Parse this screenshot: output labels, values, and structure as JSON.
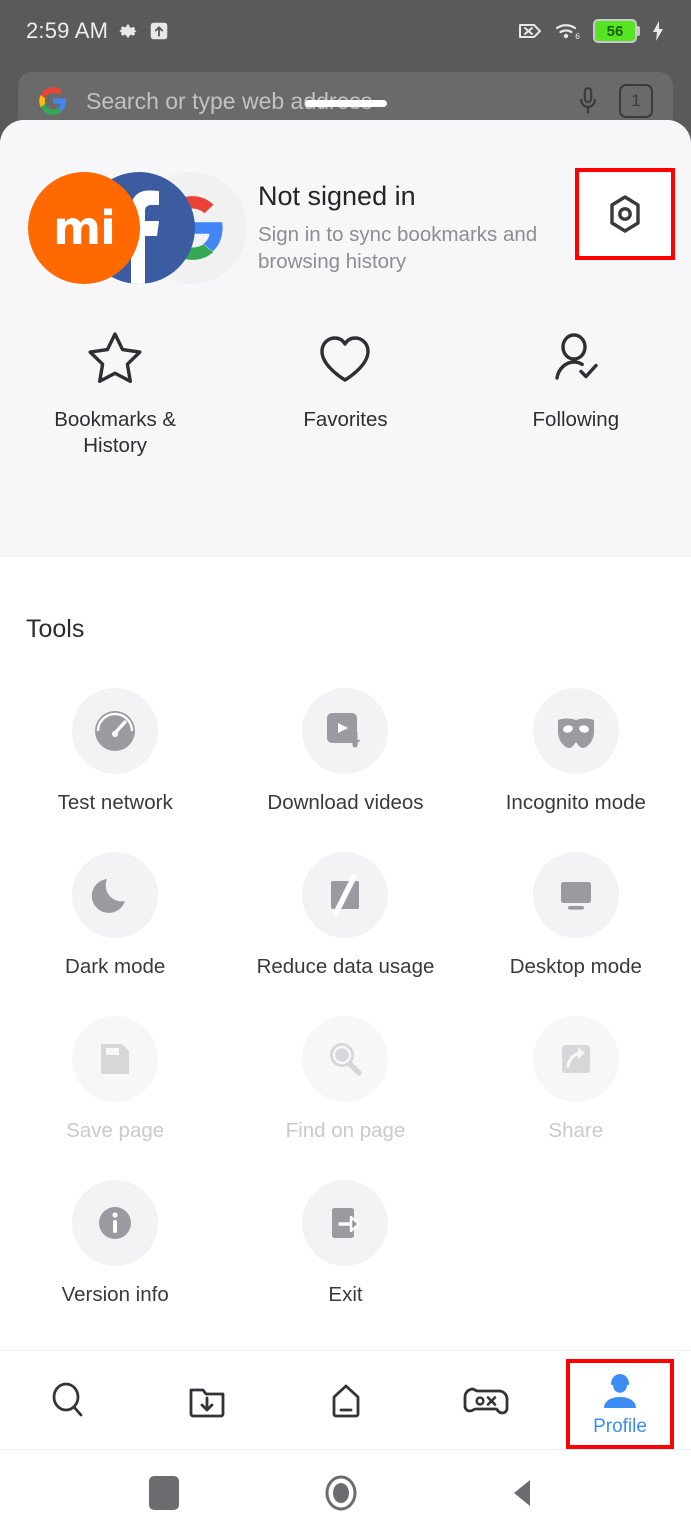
{
  "statusbar": {
    "time": "2:59 AM",
    "left_icons": [
      "gear-icon",
      "upload-box-icon"
    ],
    "right_icons": [
      "no-sim-icon",
      "wifi-6-icon",
      "battery-icon",
      "charging-bolt-icon"
    ],
    "battery_percent": "56",
    "battery_color": "#57e523"
  },
  "urlbar": {
    "placeholder": "Search or type web address",
    "leading_icon": "google-g-icon",
    "mic_icon": "microphone-icon",
    "tab_count": "1"
  },
  "account": {
    "title": "Not signed in",
    "subtitle": "Sign in to sync bookmarks and browsing history",
    "avatars": [
      {
        "name": "mi-avatar",
        "glyph": "mi",
        "color": "#ff6900"
      },
      {
        "name": "facebook-avatar",
        "glyph": "f",
        "color": "#3b5ca0"
      },
      {
        "name": "google-avatar",
        "glyph": "G",
        "color": "#f1f1f1"
      }
    ],
    "settings_icon": "settings-hex-icon",
    "settings_highlight_color": "#fe0000"
  },
  "shortcuts": [
    {
      "label": "Bookmarks & History",
      "icon": "star-icon"
    },
    {
      "label": "Favorites",
      "icon": "heart-icon"
    },
    {
      "label": "Following",
      "icon": "person-check-icon"
    }
  ],
  "tools": {
    "title": "Tools",
    "items": [
      {
        "label": "Test network",
        "icon": "speedometer-icon",
        "disabled": false
      },
      {
        "label": "Download videos",
        "icon": "video-download-icon",
        "disabled": false
      },
      {
        "label": "Incognito mode",
        "icon": "mask-icon",
        "disabled": false
      },
      {
        "label": "Dark mode",
        "icon": "moon-icon",
        "disabled": false
      },
      {
        "label": "Reduce data usage",
        "icon": "data-saver-icon",
        "disabled": false
      },
      {
        "label": "Desktop mode",
        "icon": "monitor-icon",
        "disabled": false
      },
      {
        "label": "Save page",
        "icon": "save-page-icon",
        "disabled": true
      },
      {
        "label": "Find on page",
        "icon": "magnifier-icon",
        "disabled": true
      },
      {
        "label": "Share",
        "icon": "share-icon",
        "disabled": true
      },
      {
        "label": "Version info",
        "icon": "info-icon",
        "disabled": false
      },
      {
        "label": "Exit",
        "icon": "exit-icon",
        "disabled": false
      }
    ]
  },
  "bottomnav": {
    "items": [
      {
        "name": "search",
        "icon": "search-icon",
        "label": "",
        "active": false
      },
      {
        "name": "downloads",
        "icon": "folder-download-icon",
        "label": "",
        "active": false
      },
      {
        "name": "home",
        "icon": "home-icon",
        "label": "",
        "active": false
      },
      {
        "name": "games",
        "icon": "gamepad-icon",
        "label": "",
        "active": false
      },
      {
        "name": "profile",
        "icon": "person-icon",
        "label": "Profile",
        "active": true
      }
    ],
    "active_color": "#3c8cf5",
    "highlight_color": "#fe0000"
  },
  "androidnav": {
    "items": [
      "recents-square-icon",
      "home-circle-icon",
      "back-triangle-icon"
    ]
  }
}
